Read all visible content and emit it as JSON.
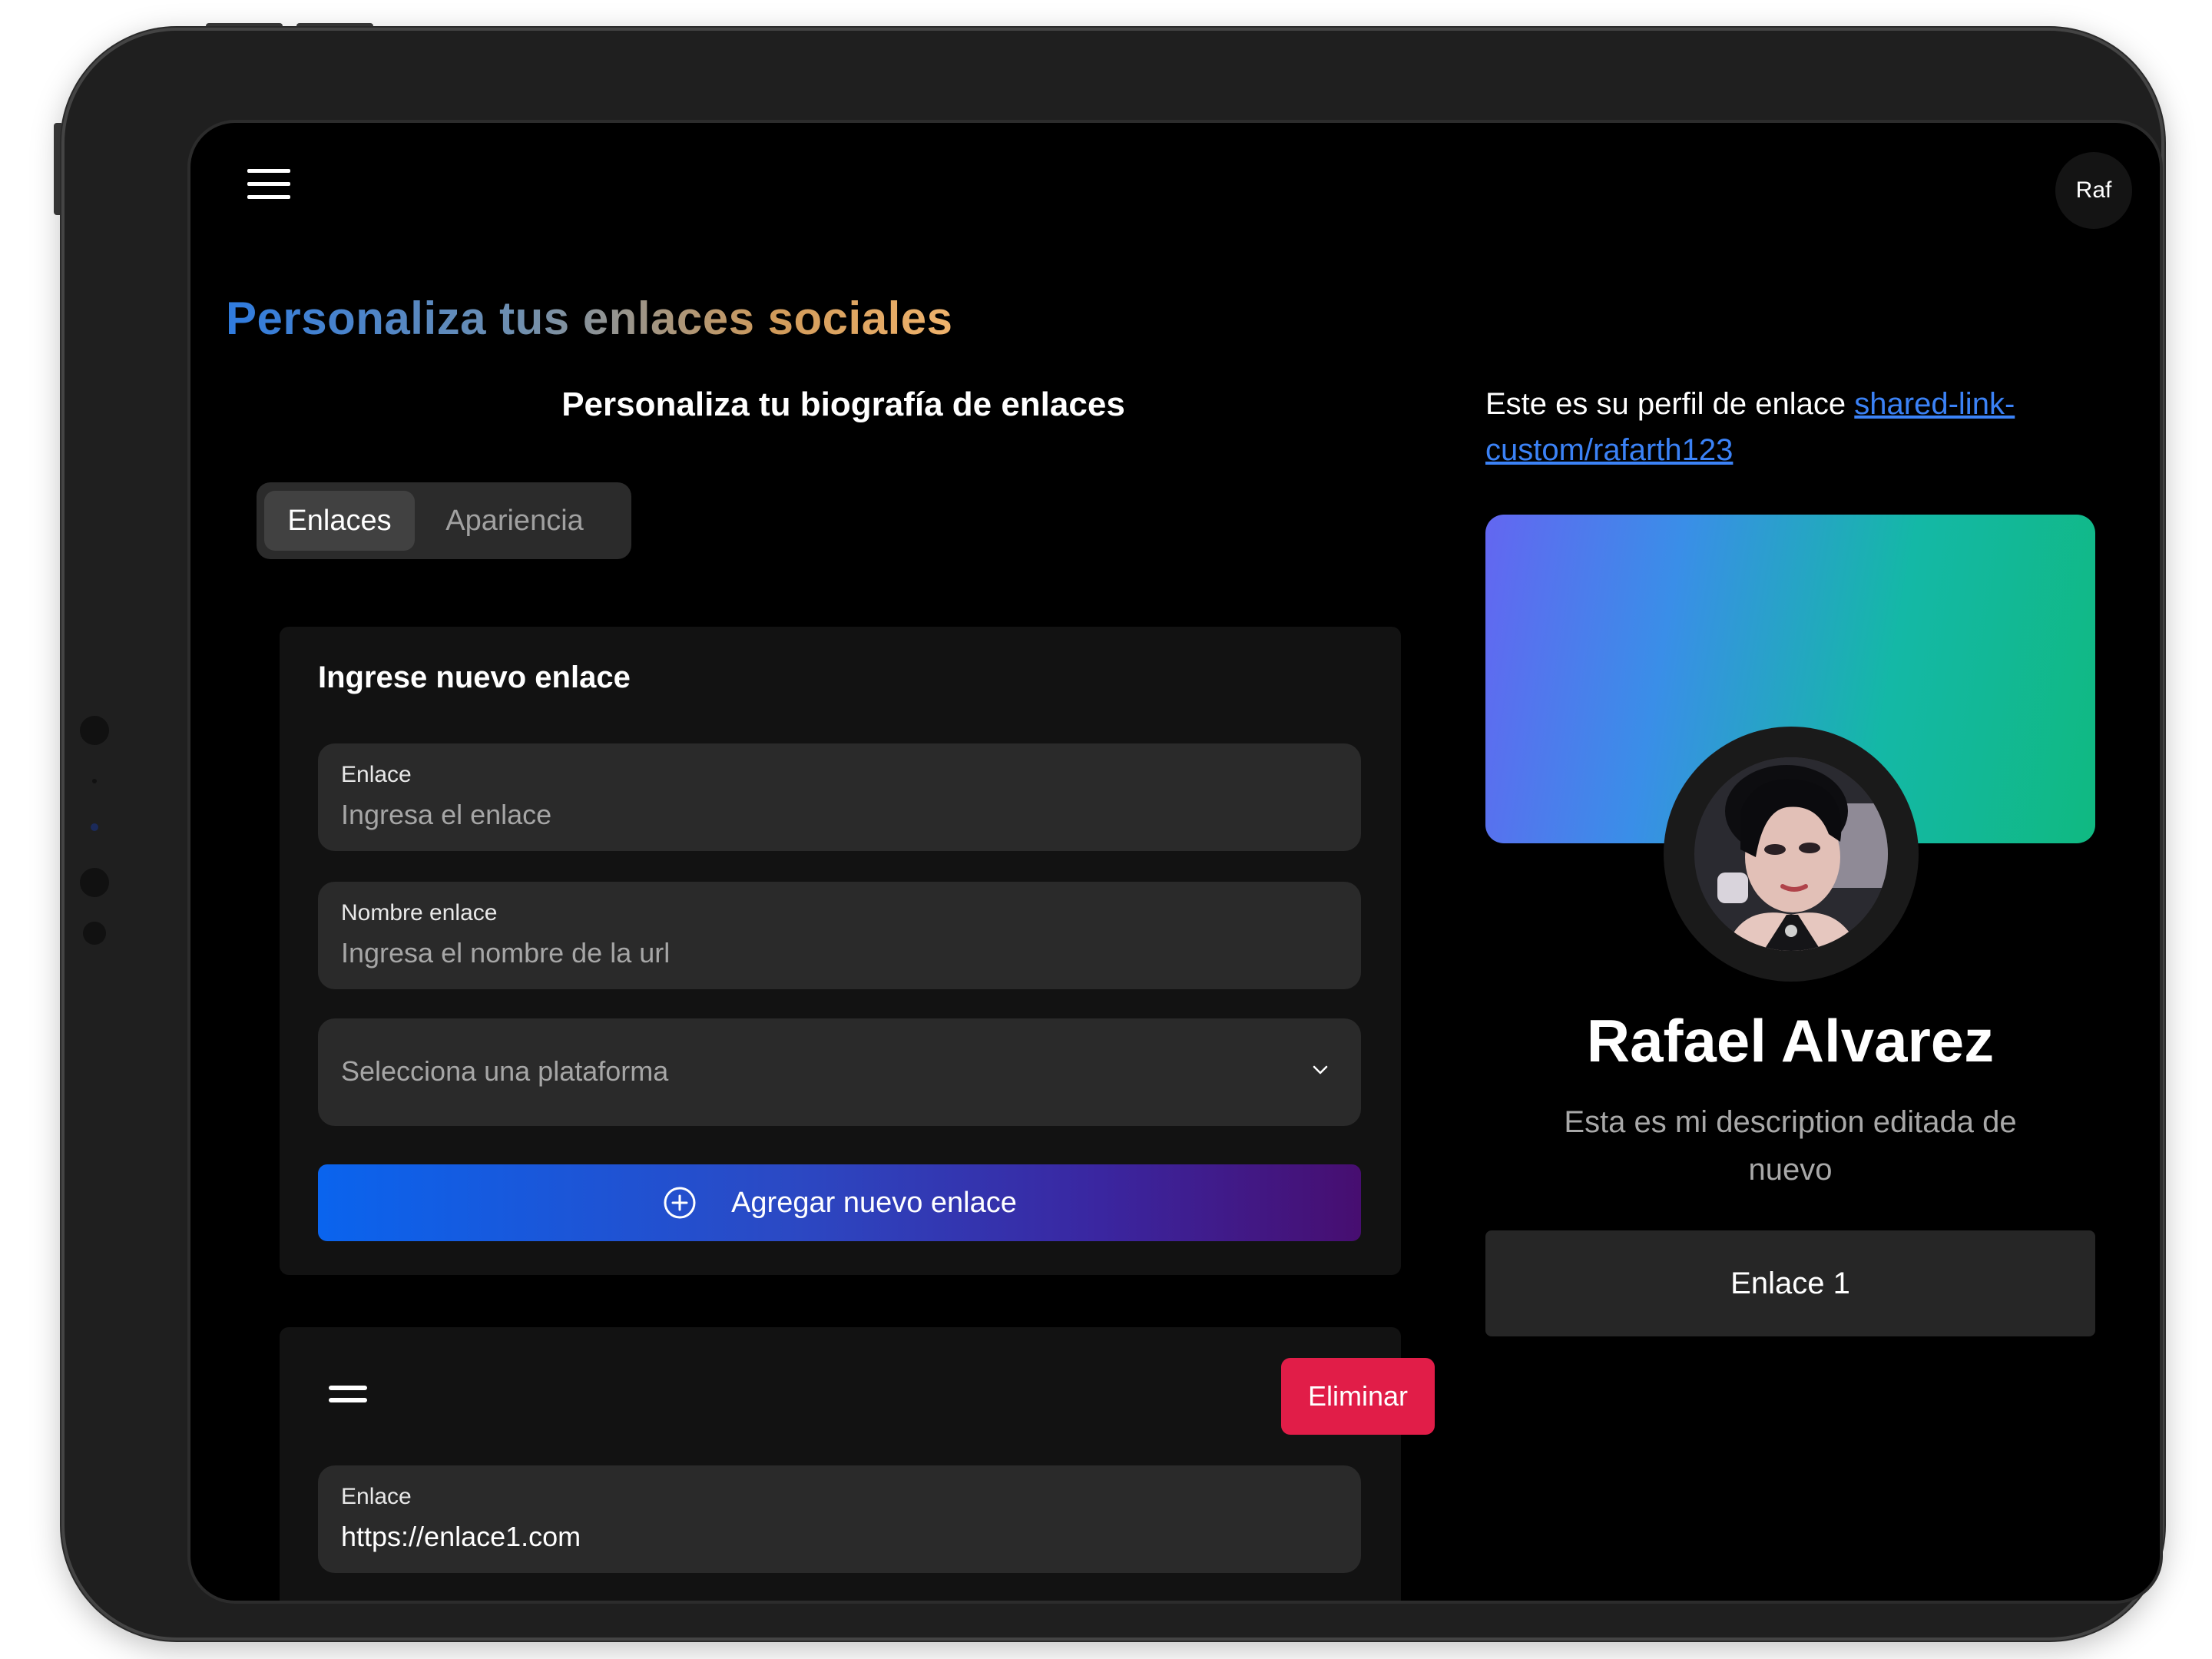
{
  "header": {
    "user_initials": "Raf"
  },
  "page": {
    "title": "Personaliza tus enlaces sociales",
    "subtitle": "Personaliza tu biografía de enlaces"
  },
  "tabs": [
    {
      "label": "Enlaces",
      "active": true
    },
    {
      "label": "Apariencia",
      "active": false
    }
  ],
  "new_link_form": {
    "title": "Ingrese nuevo enlace",
    "url_field": {
      "label": "Enlace",
      "placeholder": "Ingresa el enlace"
    },
    "name_field": {
      "label": "Nombre enlace",
      "placeholder": "Ingresa el nombre de la url"
    },
    "platform_select": {
      "placeholder": "Selecciona una plataforma"
    },
    "submit_label": "Agregar nuevo enlace"
  },
  "existing_links": [
    {
      "delete_label": "Eliminar",
      "url_label": "Enlace",
      "url_value": "https://enlace1.com"
    }
  ],
  "preview": {
    "intro": "Este es su perfil de enlace",
    "profile_link": "shared-link-custom/rafarth123",
    "name": "Rafael Alvarez",
    "description": "Esta es mi description editada de nuevo",
    "links": [
      "Enlace 1"
    ]
  },
  "colors": {
    "background": "#000000",
    "card": "#121212",
    "field": "#2a2a2a",
    "danger": "#e11d48",
    "link": "#3b82f6",
    "button_gradient": [
      "#0a64ee",
      "#470e70"
    ],
    "banner_gradient": [
      "#6366f1",
      "#10b981"
    ]
  },
  "icons": [
    "menu-icon",
    "plus-circle-icon",
    "chevron-down-icon",
    "drag-handle-icon"
  ]
}
